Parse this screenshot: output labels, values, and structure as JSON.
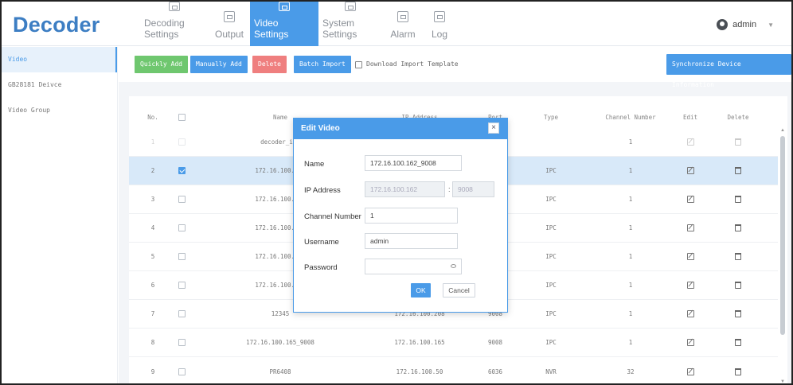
{
  "app": {
    "logo": "Decoder"
  },
  "nav": [
    {
      "label": "Decoding Settings",
      "icon": "decoding-settings-icon"
    },
    {
      "label": "Output",
      "icon": "output-icon"
    },
    {
      "label": "Video Settings",
      "icon": "video-settings-icon",
      "active": true
    },
    {
      "label": "System Settings",
      "icon": "system-settings-icon"
    },
    {
      "label": "Alarm",
      "icon": "alarm-icon"
    },
    {
      "label": "Log",
      "icon": "log-icon"
    }
  ],
  "user": {
    "name": "admin",
    "caret": "▼"
  },
  "sidebar": {
    "items": [
      {
        "label": "Video",
        "active": true
      },
      {
        "label": "GB28181 Deivce"
      },
      {
        "label": "Video Group"
      }
    ]
  },
  "toolbar": {
    "quickly_add": "Quickly Add",
    "manually_add": "Manually Add",
    "delete": "Delete",
    "batch_import": "Batch Import",
    "download_template": "Download Import Template",
    "sync": "Synchronize Device Information"
  },
  "colors": {
    "accent": "#4a9be8",
    "green": "#6fc76f",
    "red": "#ef7f7f",
    "logo": "#3d7ec3"
  },
  "table": {
    "headers": {
      "no": "No.",
      "name": "Name",
      "ip": "IP Address",
      "port": "Port",
      "type": "Type",
      "channel": "Channel Number",
      "edit": "Edit",
      "delete": "Delete"
    },
    "rows": [
      {
        "no": "1",
        "name": "decoder_inp",
        "ip": "",
        "port": "",
        "type": "",
        "channel": "1",
        "checked": false,
        "disabled": true
      },
      {
        "no": "2",
        "name": "172.16.100.162",
        "ip": "",
        "port": "",
        "type": "IPC",
        "channel": "1",
        "checked": true,
        "selected": true
      },
      {
        "no": "3",
        "name": "172.16.100.167",
        "ip": "",
        "port": "",
        "type": "IPC",
        "channel": "1",
        "checked": false
      },
      {
        "no": "4",
        "name": "172.16.100.161",
        "ip": "",
        "port": "",
        "type": "IPC",
        "channel": "1",
        "checked": false
      },
      {
        "no": "5",
        "name": "172.16.100.153",
        "ip": "",
        "port": "",
        "type": "IPC",
        "channel": "1",
        "checked": false
      },
      {
        "no": "6",
        "name": "172.16.100.163",
        "ip": "",
        "port": "",
        "type": "IPC",
        "channel": "1",
        "checked": false
      },
      {
        "no": "7",
        "name": "12345",
        "ip": "172.16.100.208",
        "port": "9008",
        "type": "IPC",
        "channel": "1",
        "checked": false
      },
      {
        "no": "8",
        "name": "172.16.100.165_9008",
        "ip": "172.16.100.165",
        "port": "9008",
        "type": "IPC",
        "channel": "1",
        "checked": false
      },
      {
        "no": "9",
        "name": "PR6408",
        "ip": "172.16.100.50",
        "port": "6036",
        "type": "NVR",
        "channel": "32",
        "checked": false
      }
    ]
  },
  "modal": {
    "title": "Edit Video",
    "close": "×",
    "name_label": "Name",
    "name_value": "172.16.100.162_9008",
    "ip_label": "IP Address",
    "ip_placeholder": "172.16.100.162",
    "port_placeholder": "9008",
    "colon": ":",
    "channel_label": "Channel Number",
    "channel_value": "1",
    "username_label": "Username",
    "username_value": "admin",
    "password_label": "Password",
    "password_value": "",
    "ok": "OK",
    "cancel": "Cancel"
  }
}
